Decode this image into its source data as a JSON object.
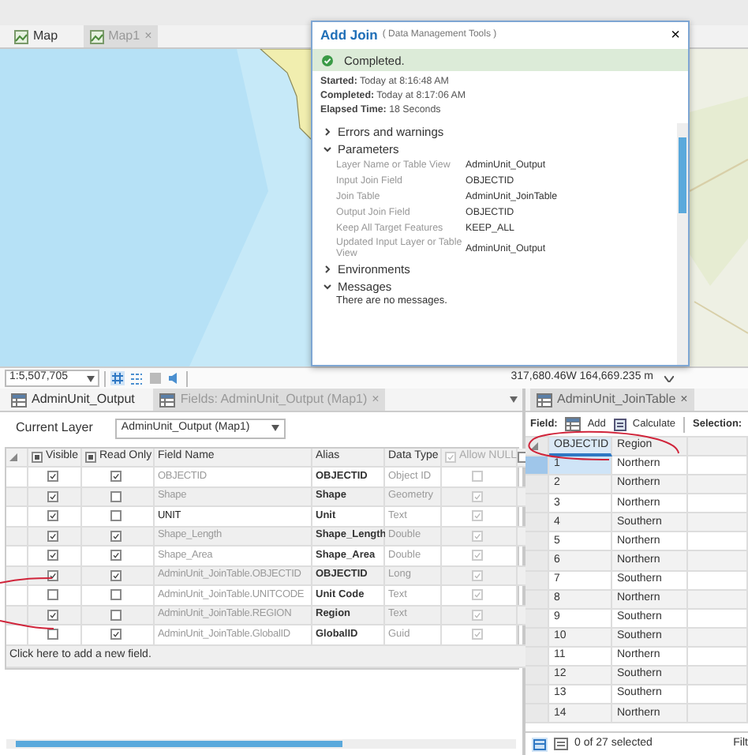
{
  "map_tabs": [
    {
      "label": "Map",
      "selected": true
    },
    {
      "label": "Map1",
      "selected": false,
      "close": "×"
    }
  ],
  "tool_dialog": {
    "title": "Add Join",
    "subtitle": "( Data Management Tools )",
    "close": "×",
    "status": "Completed.",
    "summary": [
      "**Started:** Today at 8:16:48 AM",
      "**Completed:** Today at 8:17:06 AM",
      "**Elapsed Time:** 18 Seconds"
    ],
    "sections": [
      {
        "title": "Errors and warnings",
        "expanded": false
      },
      {
        "title": "Parameters",
        "expanded": true,
        "parameters": [
          {
            "label": "Layer Name or Table View",
            "value": "AdminUnit_Output"
          },
          {
            "label": "Input Join Field",
            "value": "OBJECTID"
          },
          {
            "label": "Join Table",
            "value": "AdminUnit_JoinTable"
          },
          {
            "label": "Output Join Field",
            "value": "OBJECTID"
          },
          {
            "label": "Keep All Target Features",
            "value": "KEEP_ALL"
          },
          {
            "label": "Updated Input Layer or Table View",
            "value": "AdminUnit_Output"
          }
        ]
      },
      {
        "title": "Environments",
        "expanded": false
      },
      {
        "title": "Messages",
        "expanded": true,
        "message": "There are no messages."
      }
    ]
  },
  "map_status": {
    "scale": "1:5,507,705",
    "coordinates": "317,680.46W 164,669.235 m"
  },
  "fields_view": {
    "tabs": [
      {
        "label": "AdminUnit_Output",
        "selected": true
      },
      {
        "label": "Fields: AdminUnit_Output (Map1)",
        "selected": false,
        "close": "×"
      }
    ],
    "current_layer_label": "Current Layer",
    "current_layer": "AdminUnit_Output (Map1)",
    "columns": [
      {
        "label": "Visible",
        "indeterminate": true
      },
      {
        "label": "Read Only",
        "indeterminate": true
      },
      {
        "label": "Field Name"
      },
      {
        "label": "Alias"
      },
      {
        "label": "Data Type"
      },
      {
        "label": "Allow NULL",
        "checked": true,
        "disabled": true
      },
      {
        "checked": false
      }
    ],
    "fields": [
      {
        "visible": true,
        "read_only": true,
        "name": "OBJECTID",
        "dimmed": true,
        "alias": "OBJECTID",
        "data_type": "Object ID",
        "allow_null": false
      },
      {
        "visible": true,
        "read_only": false,
        "name": "Shape",
        "dimmed": true,
        "alias": "Shape",
        "data_type": "Geometry",
        "allow_null": true
      },
      {
        "visible": true,
        "read_only": false,
        "name": "UNIT",
        "dimmed": false,
        "alias": "Unit",
        "data_type": "Text",
        "allow_null": true
      },
      {
        "visible": true,
        "read_only": true,
        "name": "Shape_Length",
        "dimmed": true,
        "alias": "Shape_Length",
        "data_type": "Double",
        "allow_null": true
      },
      {
        "visible": true,
        "read_only": true,
        "name": "Shape_Area",
        "dimmed": true,
        "alias": "Shape_Area",
        "data_type": "Double",
        "allow_null": true
      },
      {
        "visible": true,
        "read_only": true,
        "name": "AdminUnit_JoinTable.OBJECTID",
        "dimmed": true,
        "alias": "OBJECTID",
        "data_type": "Long",
        "allow_null": true
      },
      {
        "visible": false,
        "read_only": false,
        "name": "AdminUnit_JoinTable.UNITCODE",
        "dimmed": true,
        "alias": "Unit Code",
        "data_type": "Text",
        "allow_null": true
      },
      {
        "visible": true,
        "read_only": false,
        "name": "AdminUnit_JoinTable.REGION",
        "dimmed": true,
        "alias": "Region",
        "data_type": "Text",
        "allow_null": true
      },
      {
        "visible": false,
        "read_only": true,
        "name": "AdminUnit_JoinTable.GlobalID",
        "dimmed": true,
        "alias": "GlobalID",
        "data_type": "Guid",
        "allow_null": true
      }
    ],
    "add_row": "Click here to add a new field."
  },
  "join_table": {
    "tab": {
      "label": "AdminUnit_JoinTable",
      "close": "×"
    },
    "toolbar": {
      "field_label": "Field:",
      "add": "Add",
      "calculate": "Calculate",
      "selection_label": "Selection:"
    },
    "columns": [
      "OBJECTID",
      "Region"
    ],
    "rows": [
      {
        "objectid": "1",
        "region": "Northern",
        "selected": true
      },
      {
        "objectid": "2",
        "region": "Northern",
        "selected": false
      },
      {
        "objectid": "3",
        "region": "Northern",
        "selected": false
      },
      {
        "objectid": "4",
        "region": "Southern",
        "selected": false
      },
      {
        "objectid": "5",
        "region": "Northern",
        "selected": false
      },
      {
        "objectid": "6",
        "region": "Northern",
        "selected": false
      },
      {
        "objectid": "7",
        "region": "Southern",
        "selected": false
      },
      {
        "objectid": "8",
        "region": "Northern",
        "selected": false
      },
      {
        "objectid": "9",
        "region": "Southern",
        "selected": false
      },
      {
        "objectid": "10",
        "region": "Southern",
        "selected": false
      },
      {
        "objectid": "11",
        "region": "Northern",
        "selected": false
      },
      {
        "objectid": "12",
        "region": "Southern",
        "selected": false
      },
      {
        "objectid": "13",
        "region": "Southern",
        "selected": false
      },
      {
        "objectid": "14",
        "region": "Northern",
        "selected": false
      }
    ],
    "status": "0 of 27 selected",
    "filter": "Filt"
  }
}
